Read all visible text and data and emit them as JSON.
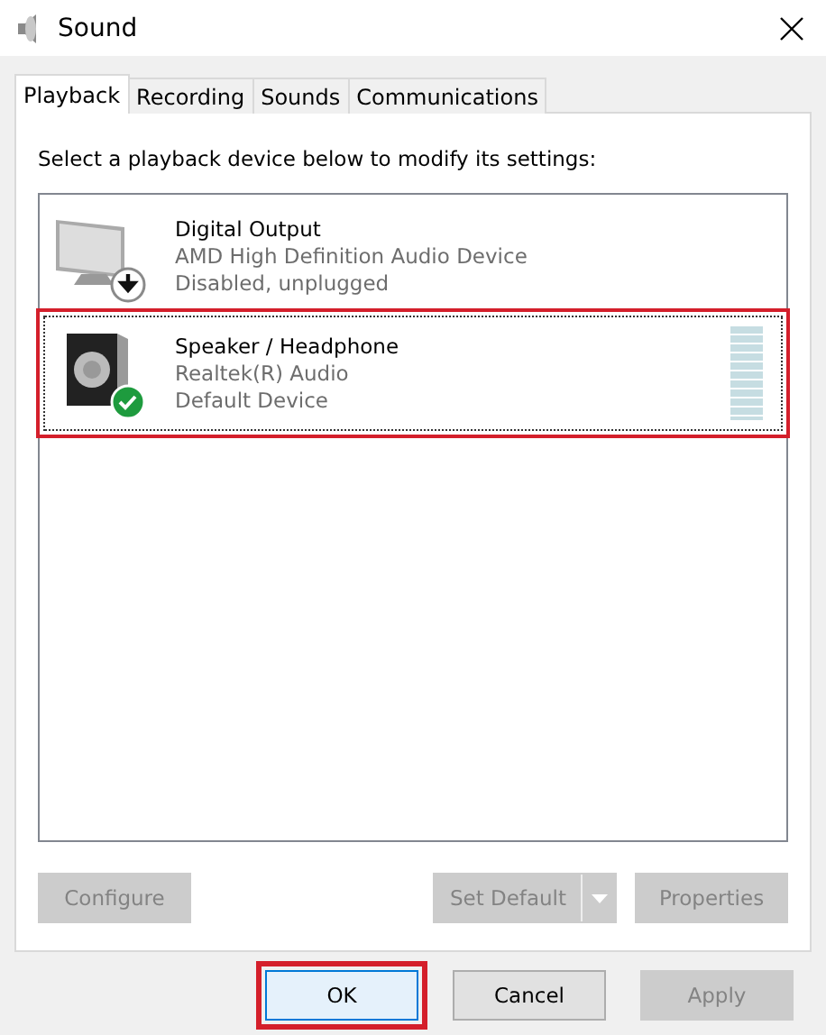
{
  "window": {
    "title": "Sound"
  },
  "tabs": [
    {
      "label": "Playback",
      "selected": true
    },
    {
      "label": "Recording",
      "selected": false
    },
    {
      "label": "Sounds",
      "selected": false
    },
    {
      "label": "Communications",
      "selected": false
    }
  ],
  "instruction": "Select a playback device below to modify its settings:",
  "devices": [
    {
      "kind": "monitor",
      "default_device": false,
      "name": "Digital Output",
      "driver": "AMD High Definition Audio Device",
      "state": "Disabled, unplugged",
      "selected": false,
      "highlighted": false
    },
    {
      "kind": "speaker",
      "default_device": true,
      "name": "Speaker / Headphone",
      "driver": "Realtek(R) Audio",
      "state": "Default Device",
      "selected": true,
      "highlighted": true
    }
  ],
  "device_buttons": [
    {
      "kind": "button",
      "label": "Configure",
      "disabled": true
    },
    {
      "kind": "split",
      "label": "Set Default",
      "disabled": true
    },
    {
      "kind": "button",
      "label": "Properties",
      "disabled": true
    }
  ],
  "dialog_buttons": [
    {
      "label": "OK",
      "disabled": false,
      "highlighted": true
    },
    {
      "label": "Cancel",
      "disabled": false,
      "highlighted": false
    },
    {
      "label": "Apply",
      "disabled": true,
      "highlighted": false
    }
  ]
}
